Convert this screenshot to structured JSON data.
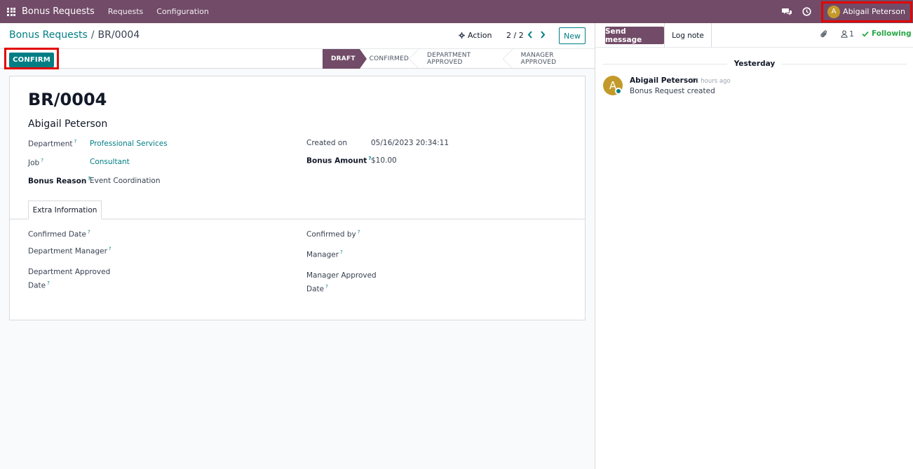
{
  "navbar": {
    "app_name": "Bonus Requests",
    "menu": [
      "Requests",
      "Configuration"
    ],
    "user": {
      "initial": "A",
      "name": "Abigail Peterson"
    }
  },
  "control": {
    "breadcrumb_parent": "Bonus Requests",
    "breadcrumb_separator": "/",
    "breadcrumb_current": "BR/0004",
    "action_label": "Action",
    "pager": "2 / 2",
    "new_label": "New",
    "confirm_label": "CONFIRM"
  },
  "statusbar": {
    "stages": [
      "DRAFT",
      "CONFIRMED",
      "DEPARTMENT APPROVED",
      "MANAGER APPROVED"
    ],
    "active_index": 0
  },
  "form": {
    "reference": "BR/0004",
    "employee": "Abigail Peterson",
    "fields": {
      "department_label": "Department",
      "department_value": "Professional Services",
      "job_label": "Job",
      "job_value": "Consultant",
      "bonus_reason_label": "Bonus Reason",
      "bonus_reason_value": "Event Coordination",
      "created_on_label": "Created on",
      "created_on_value": "05/16/2023 20:34:11",
      "bonus_amount_label": "Bonus Amount",
      "bonus_amount_value": "$10.00"
    },
    "tab_label": "Extra Information",
    "extra": {
      "confirmed_date_label": "Confirmed Date",
      "department_manager_label": "Department Manager",
      "department_approved_date_label_1": "Department Approved",
      "department_approved_date_label_2": "Date",
      "confirmed_by_label": "Confirmed by",
      "manager_label": "Manager",
      "manager_approved_date_label_1": "Manager Approved",
      "manager_approved_date_label_2": "Date"
    },
    "help_mark": "?"
  },
  "chatter": {
    "send_message_label": "Send message",
    "log_note_label": "Log note",
    "followers_count": "1",
    "following_label": "Following",
    "day_separator": "Yesterday",
    "message": {
      "avatar_initial": "A",
      "author": "Abigail Peterson",
      "time": "- 14 hours ago",
      "body": "Bonus Request created"
    }
  },
  "colors": {
    "brand": "#714b67",
    "accent": "#017e84",
    "highlight": "#e10600",
    "following": "#28a745"
  }
}
